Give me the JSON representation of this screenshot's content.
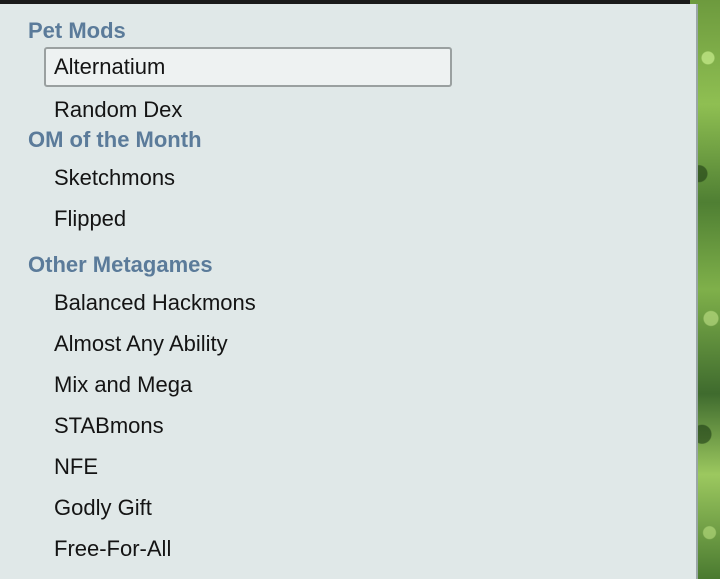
{
  "format_list": {
    "groups": [
      {
        "header": "Pet Mods",
        "items": [
          "Alternatium",
          "Random Dex"
        ]
      },
      {
        "header": "OM of the Month",
        "items": [
          "Sketchmons",
          "Flipped"
        ]
      },
      {
        "header": "Other Metagames",
        "items": [
          "Balanced Hackmons",
          "Almost Any Ability",
          "Mix and Mega",
          "STABmons",
          "NFE",
          "Godly Gift",
          "Free-For-All"
        ]
      }
    ],
    "selected_item": "Alternatium"
  },
  "colors": {
    "panel_background": "#e0e8e8",
    "group_header": "#5b7b9a",
    "item_text": "#141414",
    "selected_border": "#9aa0a0"
  }
}
